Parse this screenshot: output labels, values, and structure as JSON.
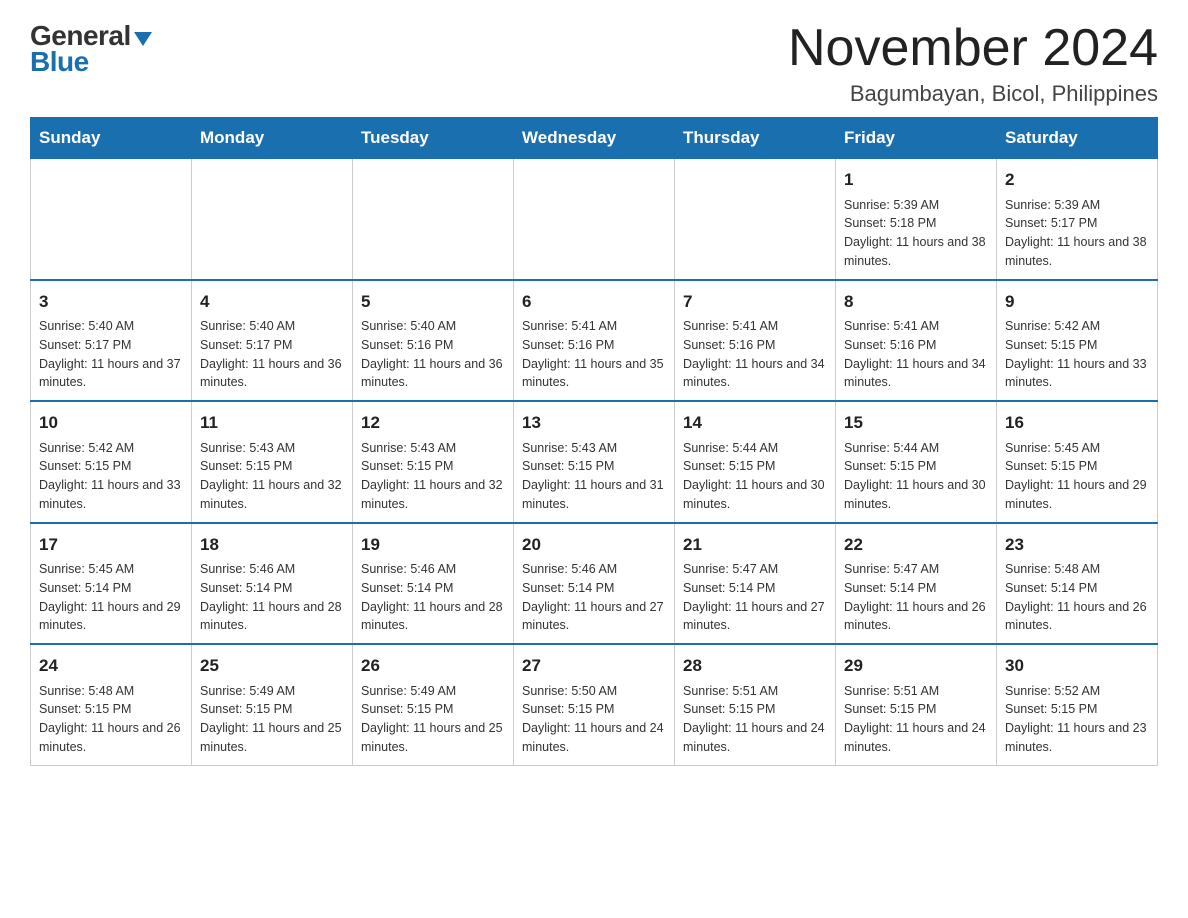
{
  "logo": {
    "general": "General",
    "blue": "Blue"
  },
  "title": "November 2024",
  "location": "Bagumbayan, Bicol, Philippines",
  "days_of_week": [
    "Sunday",
    "Monday",
    "Tuesday",
    "Wednesday",
    "Thursday",
    "Friday",
    "Saturday"
  ],
  "weeks": [
    [
      {
        "day": "",
        "info": ""
      },
      {
        "day": "",
        "info": ""
      },
      {
        "day": "",
        "info": ""
      },
      {
        "day": "",
        "info": ""
      },
      {
        "day": "",
        "info": ""
      },
      {
        "day": "1",
        "info": "Sunrise: 5:39 AM\nSunset: 5:18 PM\nDaylight: 11 hours and 38 minutes."
      },
      {
        "day": "2",
        "info": "Sunrise: 5:39 AM\nSunset: 5:17 PM\nDaylight: 11 hours and 38 minutes."
      }
    ],
    [
      {
        "day": "3",
        "info": "Sunrise: 5:40 AM\nSunset: 5:17 PM\nDaylight: 11 hours and 37 minutes."
      },
      {
        "day": "4",
        "info": "Sunrise: 5:40 AM\nSunset: 5:17 PM\nDaylight: 11 hours and 36 minutes."
      },
      {
        "day": "5",
        "info": "Sunrise: 5:40 AM\nSunset: 5:16 PM\nDaylight: 11 hours and 36 minutes."
      },
      {
        "day": "6",
        "info": "Sunrise: 5:41 AM\nSunset: 5:16 PM\nDaylight: 11 hours and 35 minutes."
      },
      {
        "day": "7",
        "info": "Sunrise: 5:41 AM\nSunset: 5:16 PM\nDaylight: 11 hours and 34 minutes."
      },
      {
        "day": "8",
        "info": "Sunrise: 5:41 AM\nSunset: 5:16 PM\nDaylight: 11 hours and 34 minutes."
      },
      {
        "day": "9",
        "info": "Sunrise: 5:42 AM\nSunset: 5:15 PM\nDaylight: 11 hours and 33 minutes."
      }
    ],
    [
      {
        "day": "10",
        "info": "Sunrise: 5:42 AM\nSunset: 5:15 PM\nDaylight: 11 hours and 33 minutes."
      },
      {
        "day": "11",
        "info": "Sunrise: 5:43 AM\nSunset: 5:15 PM\nDaylight: 11 hours and 32 minutes."
      },
      {
        "day": "12",
        "info": "Sunrise: 5:43 AM\nSunset: 5:15 PM\nDaylight: 11 hours and 32 minutes."
      },
      {
        "day": "13",
        "info": "Sunrise: 5:43 AM\nSunset: 5:15 PM\nDaylight: 11 hours and 31 minutes."
      },
      {
        "day": "14",
        "info": "Sunrise: 5:44 AM\nSunset: 5:15 PM\nDaylight: 11 hours and 30 minutes."
      },
      {
        "day": "15",
        "info": "Sunrise: 5:44 AM\nSunset: 5:15 PM\nDaylight: 11 hours and 30 minutes."
      },
      {
        "day": "16",
        "info": "Sunrise: 5:45 AM\nSunset: 5:15 PM\nDaylight: 11 hours and 29 minutes."
      }
    ],
    [
      {
        "day": "17",
        "info": "Sunrise: 5:45 AM\nSunset: 5:14 PM\nDaylight: 11 hours and 29 minutes."
      },
      {
        "day": "18",
        "info": "Sunrise: 5:46 AM\nSunset: 5:14 PM\nDaylight: 11 hours and 28 minutes."
      },
      {
        "day": "19",
        "info": "Sunrise: 5:46 AM\nSunset: 5:14 PM\nDaylight: 11 hours and 28 minutes."
      },
      {
        "day": "20",
        "info": "Sunrise: 5:46 AM\nSunset: 5:14 PM\nDaylight: 11 hours and 27 minutes."
      },
      {
        "day": "21",
        "info": "Sunrise: 5:47 AM\nSunset: 5:14 PM\nDaylight: 11 hours and 27 minutes."
      },
      {
        "day": "22",
        "info": "Sunrise: 5:47 AM\nSunset: 5:14 PM\nDaylight: 11 hours and 26 minutes."
      },
      {
        "day": "23",
        "info": "Sunrise: 5:48 AM\nSunset: 5:14 PM\nDaylight: 11 hours and 26 minutes."
      }
    ],
    [
      {
        "day": "24",
        "info": "Sunrise: 5:48 AM\nSunset: 5:15 PM\nDaylight: 11 hours and 26 minutes."
      },
      {
        "day": "25",
        "info": "Sunrise: 5:49 AM\nSunset: 5:15 PM\nDaylight: 11 hours and 25 minutes."
      },
      {
        "day": "26",
        "info": "Sunrise: 5:49 AM\nSunset: 5:15 PM\nDaylight: 11 hours and 25 minutes."
      },
      {
        "day": "27",
        "info": "Sunrise: 5:50 AM\nSunset: 5:15 PM\nDaylight: 11 hours and 24 minutes."
      },
      {
        "day": "28",
        "info": "Sunrise: 5:51 AM\nSunset: 5:15 PM\nDaylight: 11 hours and 24 minutes."
      },
      {
        "day": "29",
        "info": "Sunrise: 5:51 AM\nSunset: 5:15 PM\nDaylight: 11 hours and 24 minutes."
      },
      {
        "day": "30",
        "info": "Sunrise: 5:52 AM\nSunset: 5:15 PM\nDaylight: 11 hours and 23 minutes."
      }
    ]
  ]
}
